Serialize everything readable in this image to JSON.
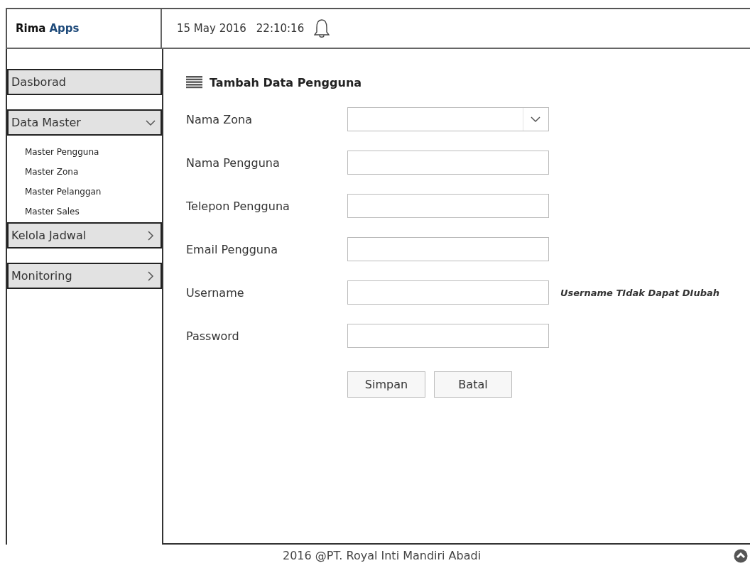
{
  "header": {
    "brand": "Rima",
    "brand_accent": "Apps",
    "date": "15 May 2016",
    "time": "22:10:16"
  },
  "sidebar": {
    "items": [
      {
        "label": "Dasborad",
        "kind": "link"
      },
      {
        "label": "Data Master",
        "kind": "group",
        "expanded": true,
        "children": [
          {
            "label": "Master Pengguna"
          },
          {
            "label": "Master Zona"
          },
          {
            "label": "Master Pelanggan"
          },
          {
            "label": "Master Sales"
          }
        ]
      },
      {
        "label": "Kelola Jadwal",
        "kind": "group",
        "expanded": false
      },
      {
        "label": "Monitoring",
        "kind": "group",
        "expanded": false
      }
    ]
  },
  "form": {
    "title": "Tambah Data Pengguna",
    "fields": [
      {
        "label": "Nama Zona",
        "kind": "select"
      },
      {
        "label": "Nama Pengguna",
        "kind": "text"
      },
      {
        "label": "Telepon Pengguna",
        "kind": "text"
      },
      {
        "label": "Email Pengguna",
        "kind": "text"
      },
      {
        "label": "Username",
        "kind": "text",
        "note": "Username TIdak Dapat DIubah"
      },
      {
        "label": "Password",
        "kind": "text"
      }
    ],
    "buttons": [
      "Simpan",
      "Batal"
    ]
  },
  "footer": {
    "text": "2016 @PT. Royal Inti Mandiri Abadi"
  }
}
